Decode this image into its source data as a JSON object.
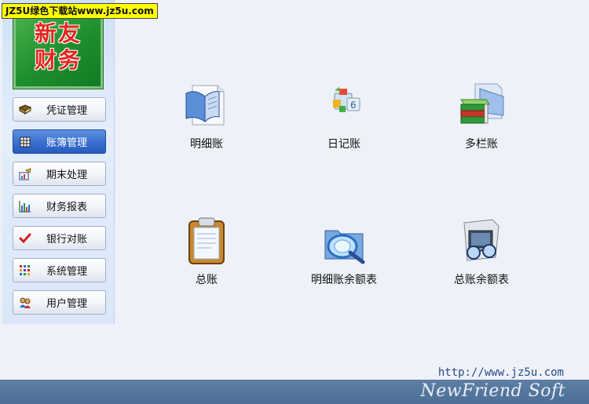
{
  "watermark": "JZ5U绿色下载站www.jz5u.com",
  "logo": {
    "text": "新友\n财务"
  },
  "sidebar": {
    "items": [
      {
        "label": "凭证管理",
        "icon": "book-icon"
      },
      {
        "label": "账簿管理",
        "icon": "ledger-icon",
        "active": true
      },
      {
        "label": "期末处理",
        "icon": "period-chart-icon"
      },
      {
        "label": "财务报表",
        "icon": "bar-chart-icon"
      },
      {
        "label": "银行对账",
        "icon": "checkmark-icon"
      },
      {
        "label": "系统管理",
        "icon": "grid-dots-icon"
      },
      {
        "label": "用户管理",
        "icon": "users-icon"
      }
    ]
  },
  "features": [
    {
      "label": "明细账",
      "icon": "open-book-icon"
    },
    {
      "label": "日记账",
      "icon": "journal-blocks-icon"
    },
    {
      "label": "多栏账",
      "icon": "stacked-books-icon"
    },
    {
      "label": "总账",
      "icon": "clipboard-icon"
    },
    {
      "label": "明细账余额表",
      "icon": "magnifier-folder-icon"
    },
    {
      "label": "总账余额表",
      "icon": "photo-glasses-icon"
    }
  ],
  "footer": {
    "url": "http://www.jz5u.com",
    "brand": "NewFriend Soft"
  },
  "colors": {
    "accent": "#3a6fd0",
    "footer": "#4d6f95",
    "logo_green": "#1f8f2f",
    "logo_text": "#e8241f"
  }
}
